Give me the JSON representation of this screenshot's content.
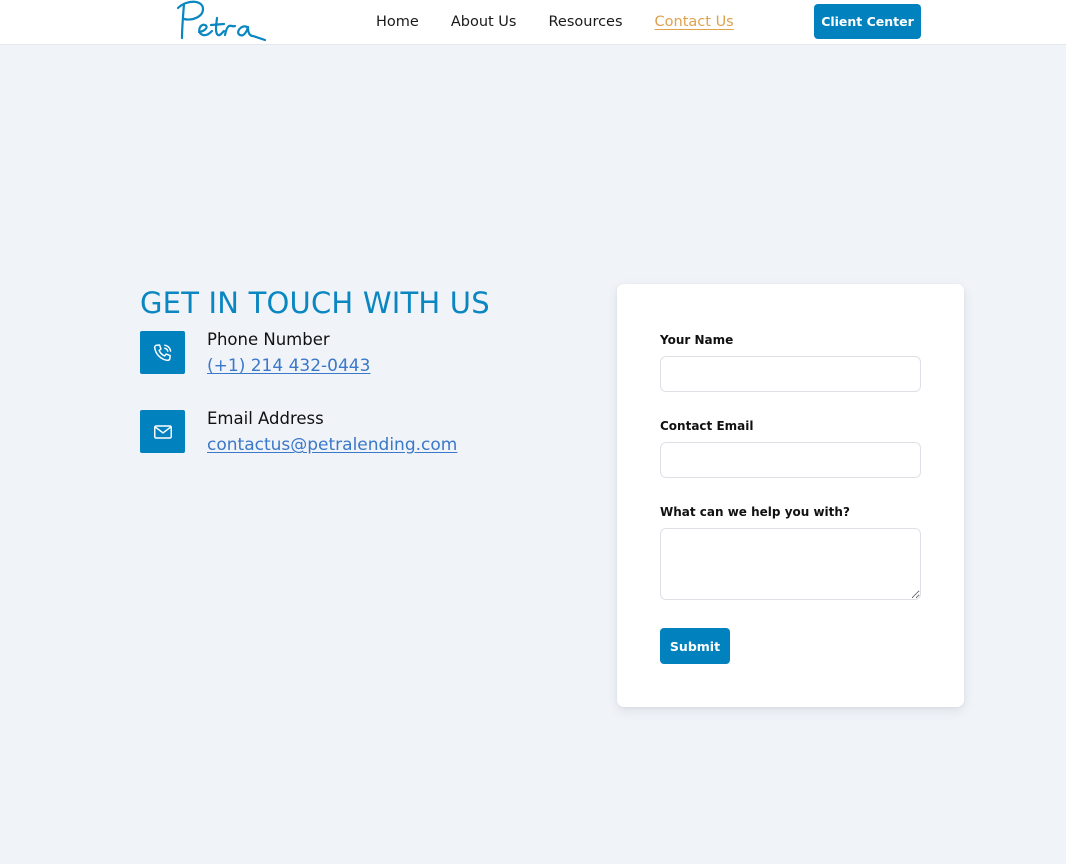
{
  "header": {
    "logo_text": "Petra",
    "nav": [
      {
        "label": "Home"
      },
      {
        "label": "About Us"
      },
      {
        "label": "Resources"
      },
      {
        "label": "Contact Us"
      }
    ],
    "client_button": "Client Center"
  },
  "contact": {
    "title": "GET IN TOUCH WITH US",
    "phone": {
      "label": "Phone Number",
      "value": "(+1) 214 432-0443",
      "icon": "phone-icon"
    },
    "email": {
      "label": "Email Address",
      "value": "contactus@petralending.com",
      "icon": "mail-icon"
    }
  },
  "form": {
    "name_label": "Your Name",
    "name_value": "",
    "email_label": "Contact Email",
    "email_value": "",
    "message_label": "What can we help you with?",
    "message_value": "",
    "submit_label": "Submit"
  },
  "colors": {
    "brand": "#0182be",
    "active_nav": "#e0a14d",
    "link": "#3a78c9",
    "background": "#f0f3f8"
  }
}
